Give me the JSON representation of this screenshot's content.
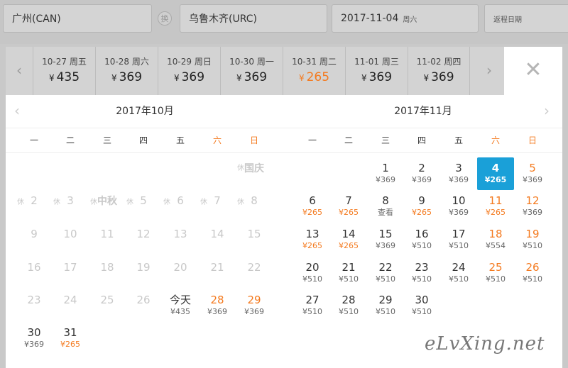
{
  "search": {
    "from": "广州(CAN)",
    "swap_label": "换",
    "to": "乌鲁木齐(URC)",
    "depart_date": "2017-11-04",
    "depart_weekday": "周六",
    "return_placeholder": "返程日期"
  },
  "strip": {
    "prev_icon": "chevron-left-icon",
    "next_icon": "chevron-right-icon",
    "tabs": [
      {
        "date": "10-27 周五",
        "currency": "¥",
        "price": "435"
      },
      {
        "date": "10-28 周六",
        "currency": "¥",
        "price": "369"
      },
      {
        "date": "10-29 周日",
        "currency": "¥",
        "price": "369"
      },
      {
        "date": "10-30 周一",
        "currency": "¥",
        "price": "369"
      },
      {
        "date": "10-31 周二",
        "currency": "¥",
        "price": "265",
        "active": true
      },
      {
        "date": "11-01 周三",
        "currency": "¥",
        "price": "369"
      },
      {
        "date": "11-02 周四",
        "currency": "¥",
        "price": "369"
      }
    ]
  },
  "calendar": {
    "left_title": "2017年10月",
    "right_title": "2017年11月",
    "weekdays": [
      "一",
      "二",
      "三",
      "四",
      "五",
      "六",
      "日"
    ],
    "rest_mark": "休",
    "october": {
      "holiday_guoqing": "国庆",
      "holiday_zhongqiu": "中秋",
      "today_label": "今天",
      "days": {
        "d2": "2",
        "d3": "3",
        "d5": "5",
        "d6": "6",
        "d7": "7",
        "d8": "8",
        "d9": "9",
        "d10": "10",
        "d11": "11",
        "d12": "12",
        "d13": "13",
        "d14": "14",
        "d15": "15",
        "d16": "16",
        "d17": "17",
        "d18": "18",
        "d19": "19",
        "d20": "20",
        "d21": "21",
        "d22": "22",
        "d23": "23",
        "d24": "24",
        "d25": "25",
        "d26": "26",
        "d28": "28",
        "d29": "29",
        "d30": "30",
        "d31": "31"
      },
      "prices": {
        "d27": "¥435",
        "d28": "¥369",
        "d29": "¥369",
        "d30": "¥369",
        "d31": "¥265"
      }
    },
    "november": {
      "days": [
        "1",
        "2",
        "3",
        "4",
        "5",
        "6",
        "7",
        "8",
        "9",
        "10",
        "11",
        "12",
        "13",
        "14",
        "15",
        "16",
        "17",
        "18",
        "19",
        "20",
        "21",
        "22",
        "23",
        "24",
        "25",
        "26",
        "27",
        "28",
        "29",
        "30"
      ],
      "prices": [
        "¥369",
        "¥369",
        "¥369",
        "¥265",
        "¥369",
        "¥265",
        "¥265",
        "查看",
        "¥265",
        "¥369",
        "¥265",
        "¥369",
        "¥265",
        "¥265",
        "¥369",
        "¥510",
        "¥510",
        "¥554",
        "¥510",
        "¥510",
        "¥510",
        "¥510",
        "¥510",
        "¥510",
        "¥510",
        "¥510",
        "¥510",
        "¥510",
        "¥510",
        "¥510"
      ]
    }
  },
  "watermark": "eLvXing.net",
  "colors": {
    "accent_orange": "#f47a1f",
    "selected_blue": "#1aa0d8"
  }
}
